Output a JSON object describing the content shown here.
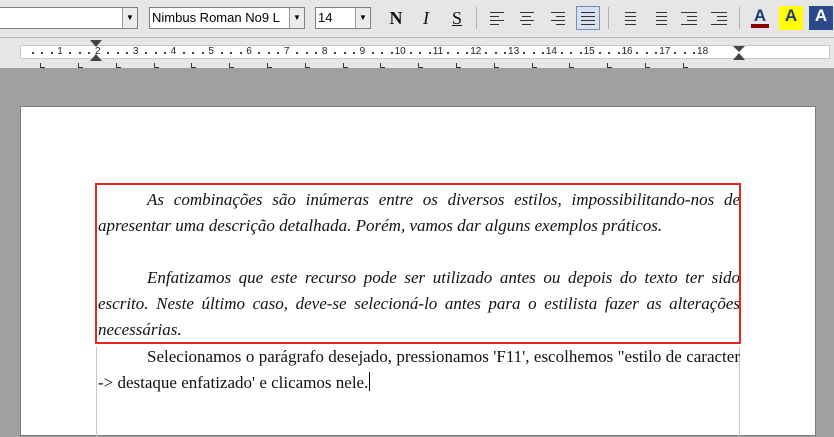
{
  "toolbar": {
    "style_value": "",
    "font_name": "Nimbus Roman No9 L",
    "font_size": "14",
    "bold_label": "N",
    "italic_label": "I",
    "underline_label": "S",
    "font_color_label": "A",
    "highlight_label": "A",
    "background_label": "A",
    "colors": {
      "font_color": "#8b0000",
      "highlight": "#ffff00",
      "background": "#2a4a8a",
      "active_bg": "#d6e0ee"
    }
  },
  "ruler": {
    "numbers": [
      "1",
      "2",
      "3",
      "4",
      "5",
      "6",
      "7",
      "8",
      "9",
      "10",
      "11",
      "12",
      "13",
      "14",
      "15",
      "16",
      "17",
      "18"
    ]
  },
  "document": {
    "paragraph_1": "As combinações são inúmeras entre os diversos estilos, impossibilitando-nos de apresentar uma descrição detalhada. Porém, vamos dar alguns exemplos práticos.",
    "paragraph_2": "Enfatizamos que este recurso pode ser utilizado antes ou depois do texto ter sido escrito. Neste último caso, deve-se selecioná-lo antes para o estilista fazer as alterações necessárias.",
    "paragraph_3": "Selecionamos o parágrafo desejado, pressionamos 'F11', escolhemos \"estilo de caracter -> destaque enfatizado' e clicamos nele.",
    "highlight_color": "#e3271f"
  }
}
